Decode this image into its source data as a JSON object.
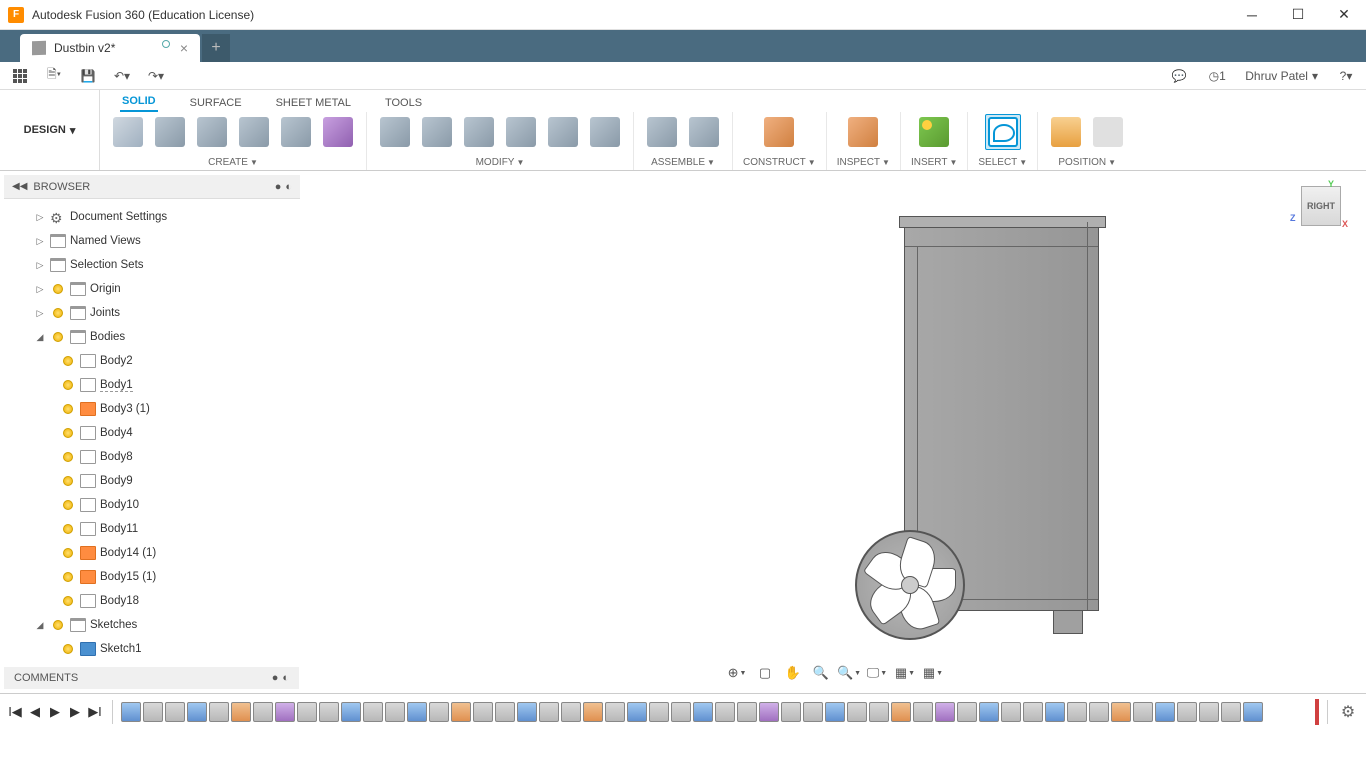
{
  "titlebar": {
    "title": "Autodesk Fusion 360 (Education License)"
  },
  "tab": {
    "name": "Dustbin v2*"
  },
  "qat": {
    "user": "Dhruv Patel",
    "jobs": "1"
  },
  "workspace": {
    "label": "DESIGN"
  },
  "ribbon_tabs": {
    "t0": "SOLID",
    "t1": "SURFACE",
    "t2": "SHEET METAL",
    "t3": "TOOLS"
  },
  "panels": {
    "create": "CREATE",
    "modify": "MODIFY",
    "assemble": "ASSEMBLE",
    "construct": "CONSTRUCT",
    "inspect": "INSPECT",
    "insert": "INSERT",
    "select": "SELECT",
    "position": "POSITION"
  },
  "browser": {
    "title": "BROWSER",
    "items": {
      "docset": "Document Settings",
      "named": "Named Views",
      "selset": "Selection Sets",
      "origin": "Origin",
      "joints": "Joints",
      "bodies": "Bodies",
      "b2": "Body2",
      "b1": "Body1",
      "b3": "Body3 (1)",
      "b4": "Body4",
      "b8": "Body8",
      "b9": "Body9",
      "b10": "Body10",
      "b11": "Body11",
      "b14": "Body14 (1)",
      "b15": "Body15 (1)",
      "b18": "Body18",
      "sketches": "Sketches",
      "sk1": "Sketch1"
    }
  },
  "viewcube": {
    "face": "RIGHT"
  },
  "comments": {
    "label": "COMMENTS"
  }
}
